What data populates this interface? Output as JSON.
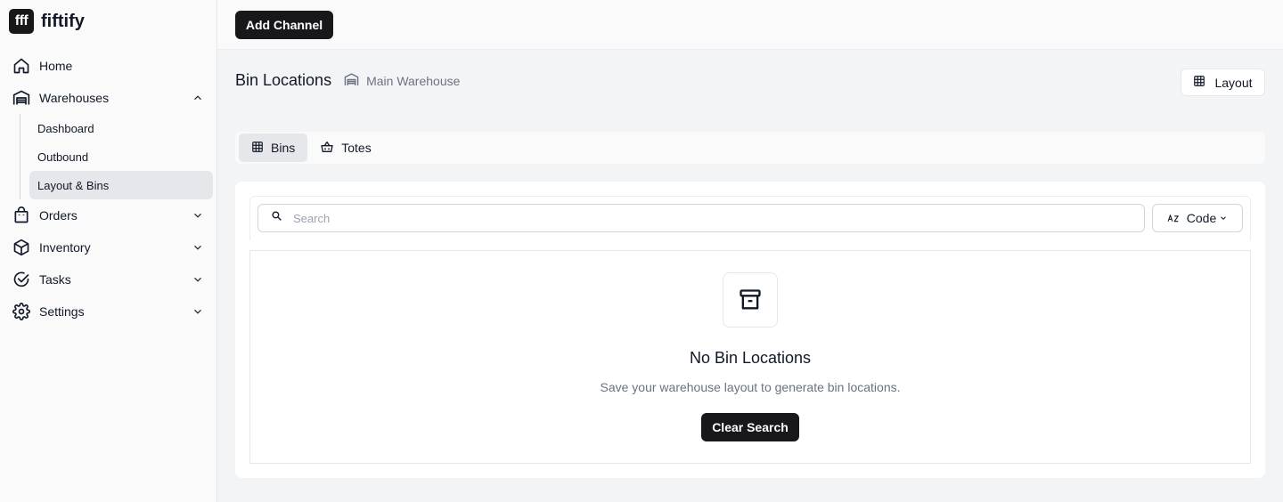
{
  "brand": {
    "logo_text": "fff",
    "name": "fiftify"
  },
  "sidebar": {
    "items": [
      {
        "label": "Home",
        "icon": "home-icon"
      },
      {
        "label": "Warehouses",
        "icon": "warehouse-icon",
        "expanded": true,
        "children": [
          {
            "label": "Dashboard",
            "active": false
          },
          {
            "label": "Outbound",
            "active": false
          },
          {
            "label": "Layout & Bins",
            "active": true
          }
        ]
      },
      {
        "label": "Orders",
        "icon": "shopping-bag-icon",
        "expanded": false
      },
      {
        "label": "Inventory",
        "icon": "box-icon",
        "expanded": false
      },
      {
        "label": "Tasks",
        "icon": "check-circle-icon",
        "expanded": false
      },
      {
        "label": "Settings",
        "icon": "gear-icon",
        "expanded": false
      }
    ]
  },
  "topbar": {
    "add_channel_label": "Add Channel"
  },
  "header": {
    "title": "Bin Locations",
    "warehouse_name": "Main Warehouse",
    "layout_button_label": "Layout"
  },
  "tabs": [
    {
      "label": "Bins",
      "icon": "grid-icon",
      "active": true
    },
    {
      "label": "Totes",
      "icon": "basket-icon",
      "active": false
    }
  ],
  "search": {
    "placeholder": "Search",
    "value": ""
  },
  "sort": {
    "label": "Code",
    "icon": "sort-az-icon"
  },
  "empty_state": {
    "icon": "archive-icon",
    "title": "No Bin Locations",
    "description": "Save your warehouse layout to generate bin locations.",
    "button_label": "Clear Search"
  }
}
